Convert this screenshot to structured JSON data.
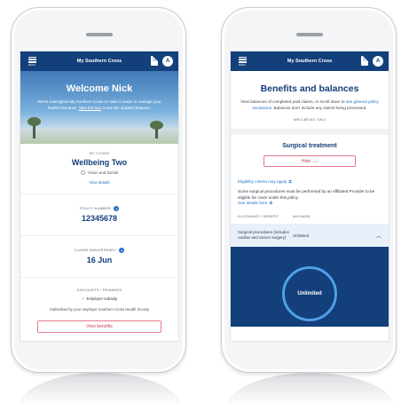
{
  "app": {
    "title": "My Southern Cross",
    "menu_label": "MENU",
    "avatar_initial": "A",
    "colors": {
      "primary": "#133f7a",
      "link": "#1f70c7",
      "accent": "#d0425d",
      "ring": "#4fa0e6"
    }
  },
  "left": {
    "welcome": "Welcome Nick",
    "hero_text": "We've redesigned My Southern Cross to make it easier to manage your health insurance.",
    "hero_link": "Take the tour",
    "hero_text2": "to see the updated features.",
    "cover_label": "MY COVER",
    "cover_name": "Wellbeing Two",
    "cover_addon": "Vision and Dental",
    "view_details": "View details",
    "policy_label": "POLICY NUMBER",
    "policy_number": "12345678",
    "claims_label": "CLAIMS ANNIVERSARY",
    "claims_date": "16 Jun",
    "discounts_label": "DISCOUNTS / REWARDS",
    "discount_item": "Employer subsidy",
    "subsidy_text": "Subsidised by your employer Southern Cross Health Society",
    "view_benefits": "View benefits"
  },
  "right": {
    "title": "Benefits and balances",
    "intro_a": "View balances of completed paid claims, or scroll down to",
    "intro_link": "see general policy exclusions",
    "intro_b": ". Balances don't include any claims being processed.",
    "plan": "WELLBEING TWO",
    "section_title": "Surgical treatment",
    "hide_label": "Hide",
    "eligibility": "Eligibility criteria may apply.",
    "surgery_note": "Some surgical procedures must be performed by an Affiliated Provider to be eligible for cover under this policy.",
    "see_details": "See details here.",
    "col_allowance": "ALLOWANCE / BENEFIT",
    "col_maximum": "MAXIMUM",
    "row_name": "Surgical procedures (includes cardiac and cancer surgery)",
    "row_value": "Unlimited",
    "ring_text": "Unlimited"
  }
}
